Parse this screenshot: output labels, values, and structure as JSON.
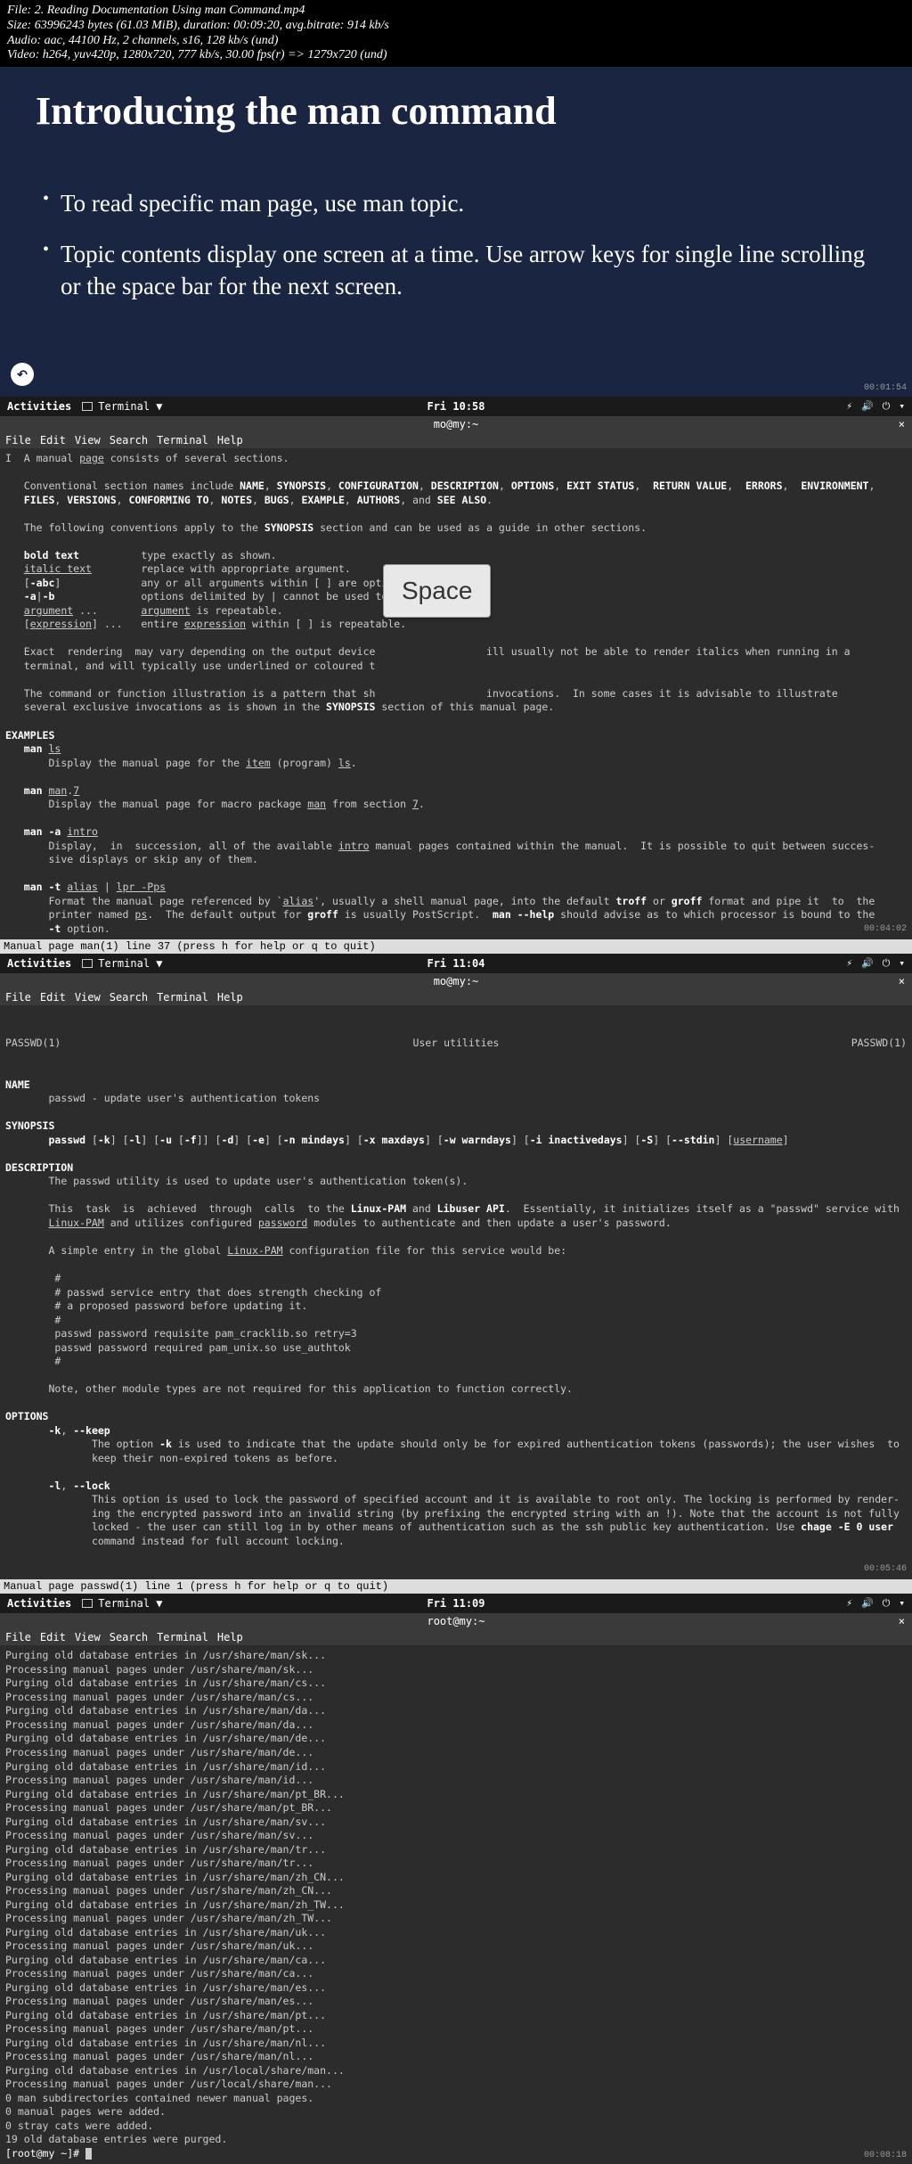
{
  "fileinfo": {
    "line1": "File: 2. Reading Documentation Using man Command.mp4",
    "line2": "Size: 63996243 bytes (61.03 MiB), duration: 00:09:20, avg.bitrate: 914 kb/s",
    "line3": "Audio: aac, 44100 Hz, 2 channels, s16, 128 kb/s (und)",
    "line4": "Video: h264, yuv420p, 1280x720, 777 kb/s, 30.00 fps(r) => 1279x720 (und)"
  },
  "slide": {
    "title": "Introducing the man command",
    "bullet1": "To read specific man page, use man topic.",
    "bullet2": "Topic contents display one screen at a time. Use arrow keys for single line scrolling or the space bar for the next screen.",
    "timestamp": "00:01:54"
  },
  "shot1": {
    "clock": "Fri 10:58",
    "title": "mo@my:~",
    "activities": "Activities",
    "app": "Terminal ▼",
    "menus": [
      "File",
      "Edit",
      "View",
      "Search",
      "Terminal",
      "Help"
    ],
    "body_html": "I  A manual <span class='u'>page</span> consists of several sections.\n\n   Conventional section names include <span class='b'>NAME</span>, <span class='b'>SYNOPSIS</span>, <span class='b'>CONFIGURATION</span>, <span class='b'>DESCRIPTION</span>, <span class='b'>OPTIONS</span>, <span class='b'>EXIT STATUS</span>,  <span class='b'>RETURN VALUE</span>,  <span class='b'>ERRORS</span>,  <span class='b'>ENVIRONMENT</span>,\n   <span class='b'>FILES</span>, <span class='b'>VERSIONS</span>, <span class='b'>CONFORMING TO</span>, <span class='b'>NOTES</span>, <span class='b'>BUGS</span>, <span class='b'>EXAMPLE</span>, <span class='b'>AUTHORS</span>, and <span class='b'>SEE ALSO</span>.\n\n   The following conventions apply to the <span class='b'>SYNOPSIS</span> section and can be used as a guide in other sections.\n\n   <span class='b'>bold text</span>          type exactly as shown.\n   <span class='u'>italic text</span>        replace with appropriate argument.\n   [<span class='b'>-abc</span>]             any or all arguments within [ ] are optional.\n   <span class='b'>-a</span>|<span class='b'>-b</span>              options delimited by | cannot be used together.\n   <span class='u'>argument</span> ...       <span class='u'>argument</span> is repeatable.\n   [<span class='u'>expression</span>] ...   entire <span class='u'>expression</span> within [ ] is repeatable.\n\n   Exact  rendering  may vary depending on the output device                  ill usually not be able to render italics when running in a\n   terminal, and will typically use underlined or coloured t\n\n   The command or function illustration is a pattern that sh                  invocations.  In some cases it is advisable to illustrate\n   several exclusive invocations as is shown in the <span class='b'>SYNOPSIS</span> section of this manual page.\n\n<span class='b'>EXAMPLES</span>\n   <span class='b'>man</span> <span class='u'>ls</span>\n       Display the manual page for the <span class='u'>item</span> (program) <span class='u'>ls</span>.\n\n   <span class='b'>man</span> <span class='u'>man</span>.<span class='u'>7</span>\n       Display the manual page for macro package <span class='u'>man</span> from section <span class='u'>7</span>.\n\n   <span class='b'>man -a</span> <span class='u'>intro</span>\n       Display,  in  succession, all of the available <span class='u'>intro</span> manual pages contained within the manual.  It is possible to quit between succes-\n       sive displays or skip any of them.\n\n   <span class='b'>man -t</span> <span class='u'>alias</span> | <span class='u'>lpr -Pps</span>\n       Format the manual page referenced by `<span class='u'>alias</span>', usually a shell manual page, into the default <span class='b'>troff</span> or <span class='b'>groff</span> format and pipe it  to  the\n       printer named <span class='u'>ps</span>.  The default output for <span class='b'>groff</span> is usually PostScript.  <span class='b'>man --help</span> should advise as to which processor is bound to the\n       <span class='b'>-t</span> option.",
    "statusline": " Manual page man(1) line 37 (press h for help or q to quit)",
    "space_label": "Space",
    "timestamp": "00:04:02"
  },
  "shot2": {
    "clock": "Fri 11:04",
    "title": "mo@my:~",
    "activities": "Activities",
    "app": "Terminal ▼",
    "menus": [
      "File",
      "Edit",
      "View",
      "Search",
      "Terminal",
      "Help"
    ],
    "hdr_left": "PASSWD(1)",
    "hdr_center": "User utilities",
    "hdr_right": "PASSWD(1)",
    "body_html": "<span class='b'>NAME</span>\n       passwd - update user's authentication tokens\n\n<span class='b'>SYNOPSIS</span>\n       <span class='b'>passwd</span> [<span class='b'>-k</span>] [<span class='b'>-l</span>] [<span class='b'>-u</span> [<span class='b'>-f</span>]] [<span class='b'>-d</span>] [<span class='b'>-e</span>] [<span class='b'>-n mindays</span>] [<span class='b'>-x maxdays</span>] [<span class='b'>-w warndays</span>] [<span class='b'>-i inactivedays</span>] [<span class='b'>-S</span>] [<span class='b'>--stdin</span>] [<span class='u'>username</span>]\n\n<span class='b'>DESCRIPTION</span>\n       The passwd utility is used to update user's authentication token(s).\n\n       This  task  is  achieved  through  calls  to the <span class='b'>Linux-PAM</span> and <span class='b'>Libuser API</span>.  Essentially, it initializes itself as a \"passwd\" service with\n       <span class='u'>Linux-PAM</span> and utilizes configured <span class='u'>password</span> modules to authenticate and then update a user's password.\n\n       A simple entry in the global <span class='u'>Linux-PAM</span> configuration file for this service would be:\n\n        #\n        # passwd service entry that does strength checking of\n        # a proposed password before updating it.\n        #\n        passwd password requisite pam_cracklib.so retry=3\n        passwd password required pam_unix.so use_authtok\n        #\n\n       Note, other module types are not required for this application to function correctly.\n\n<span class='b'>OPTIONS</span>\n       <span class='b'>-k</span>, <span class='b'>--keep</span>\n              The option <span class='b'>-k</span> is used to indicate that the update should only be for expired authentication tokens (passwords); the user wishes  to\n              keep their non-expired tokens as before.\n\n       <span class='b'>-l</span>, <span class='b'>--lock</span>\n              This option is used to lock the password of specified account and it is available to root only. The locking is performed by render-\n              ing the encrypted password into an invalid string (by prefixing the encrypted string with an !). Note that the account is not fully\n              locked - the user can still log in by other means of authentication such as the ssh public key authentication. Use <span class='b'>chage -E 0 user</span>\n              command instead for full account locking.",
    "statusline": " Manual page passwd(1) line 1 (press h for help or q to quit)",
    "timestamp": "00:05:46"
  },
  "shot3": {
    "clock": "Fri 11:09",
    "title": "root@my:~",
    "activities": "Activities",
    "app": "Terminal ▼",
    "menus": [
      "File",
      "Edit",
      "View",
      "Search",
      "Terminal",
      "Help"
    ],
    "lines": [
      "Purging old database entries in /usr/share/man/sk...",
      "Processing manual pages under /usr/share/man/sk...",
      "Purging old database entries in /usr/share/man/cs...",
      "Processing manual pages under /usr/share/man/cs...",
      "Purging old database entries in /usr/share/man/da...",
      "Processing manual pages under /usr/share/man/da...",
      "Purging old database entries in /usr/share/man/de...",
      "Processing manual pages under /usr/share/man/de...",
      "Purging old database entries in /usr/share/man/id...",
      "Processing manual pages under /usr/share/man/id...",
      "Purging old database entries in /usr/share/man/pt_BR...",
      "Processing manual pages under /usr/share/man/pt_BR...",
      "Purging old database entries in /usr/share/man/sv...",
      "Processing manual pages under /usr/share/man/sv...",
      "Purging old database entries in /usr/share/man/tr...",
      "Processing manual pages under /usr/share/man/tr...",
      "Purging old database entries in /usr/share/man/zh_CN...",
      "Processing manual pages under /usr/share/man/zh_CN...",
      "Purging old database entries in /usr/share/man/zh_TW...",
      "Processing manual pages under /usr/share/man/zh_TW...",
      "Purging old database entries in /usr/share/man/uk...",
      "Processing manual pages under /usr/share/man/uk...",
      "Purging old database entries in /usr/share/man/ca...",
      "Processing manual pages under /usr/share/man/ca...",
      "Purging old database entries in /usr/share/man/es...",
      "Processing manual pages under /usr/share/man/es...",
      "Purging old database entries in /usr/share/man/pt...",
      "Processing manual pages under /usr/share/man/pt...",
      "Purging old database entries in /usr/share/man/nl...",
      "Processing manual pages under /usr/share/man/nl...",
      "Purging old database entries in /usr/local/share/man...",
      "Processing manual pages under /usr/local/share/man...",
      "0 man subdirectories contained newer manual pages.",
      "0 manual pages were added.",
      "0 stray cats were added.",
      "19 old database entries were purged."
    ],
    "prompt": "[root@my ~]# ",
    "timestamp": "00:08:18"
  }
}
